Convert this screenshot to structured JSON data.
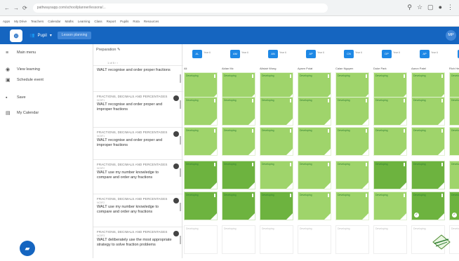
{
  "browser": {
    "url": "pathwaysapp.com/school/planner/lessons/...",
    "bookmarks": [
      "Apps",
      "My Drive",
      "Teachers",
      "Calendar",
      "Maths",
      "Learning",
      "Class",
      "Report",
      "Pupils",
      "Rota",
      "Resources"
    ]
  },
  "appbar": {
    "org": "Pupil",
    "plan_button": "Lesson planning",
    "avatar": "MP"
  },
  "sidebar": {
    "items": [
      "Main menu",
      "View learning",
      "Schedule event",
      "Save",
      "My Calendar"
    ]
  },
  "lessons_panel": {
    "title": "Preparation",
    "subtitle": "1 of 5",
    "rows": [
      {
        "strand": "",
        "code": "",
        "text": "WALT recognise and order proper fractions"
      },
      {
        "strand": "FRACTIONS, DECIMALS AND PERCENTAGES",
        "code": "NC5F1",
        "text": "WALT recognise and order proper and improper fractions"
      },
      {
        "strand": "FRACTIONS, DECIMALS AND PERCENTAGES",
        "code": "NC5F1",
        "text": "WALT recognise and order proper and improper fractions"
      },
      {
        "strand": "FRACTIONS, DECIMALS AND PERCENTAGES",
        "code": "NC5F2",
        "text": "WALT use my number knowledge to compare and order any fractions"
      },
      {
        "strand": "FRACTIONS, DECIMALS AND PERCENTAGES",
        "code": "NC5F2",
        "text": "WALT use my number knowledge to compare and order any fractions"
      },
      {
        "strand": "FRACTIONS, DECIMALS AND PERCENTAGES",
        "code": "NC5F3",
        "text": "WALT deliberately use the most appropriate strategy to solve fraction problems"
      }
    ]
  },
  "students": [
    {
      "initials": "AL",
      "year": "Year 6",
      "name": "Ali"
    },
    {
      "initials": "AM",
      "year": "Year 6",
      "name": "Aidan Mc"
    },
    {
      "initials": "AN",
      "year": "Year 6",
      "name": "Alistair Wong"
    },
    {
      "initials": "AP",
      "year": "Year 6",
      "name": "Aysen Polat"
    },
    {
      "initials": "CN",
      "year": "Year 6",
      "name": "Calan Nguyen"
    },
    {
      "initials": "DP",
      "year": "Year 6",
      "name": "Duke Park"
    },
    {
      "initials": "AP",
      "year": "Year 6",
      "name": "Aaron Patel"
    },
    {
      "initials": "RH",
      "year": "Year 6",
      "name": "Rich Hernandez"
    }
  ],
  "cell_label": "Developing",
  "grid": [
    [
      "light",
      "light",
      "light",
      "light",
      "light",
      "light",
      "light",
      "light"
    ],
    [
      "light",
      "light",
      "light",
      "light",
      "light",
      "light",
      "light",
      "light"
    ],
    [
      "light",
      "light",
      "light",
      "light",
      "light",
      "light",
      "light",
      "light"
    ],
    [
      "mid",
      "mid",
      "light",
      "light",
      "light",
      "mid",
      "mid",
      "light"
    ],
    [
      "mid",
      "mid",
      "mid",
      "light",
      "light",
      "light",
      "done",
      "done"
    ],
    [
      "none",
      "none",
      "none",
      "none",
      "none",
      "none",
      "none",
      "none"
    ]
  ],
  "colors": {
    "brand": "#1565c0",
    "light": "#9fd46b",
    "mid": "#6db33f",
    "done": "#6db33f",
    "none": "#ffffff"
  }
}
